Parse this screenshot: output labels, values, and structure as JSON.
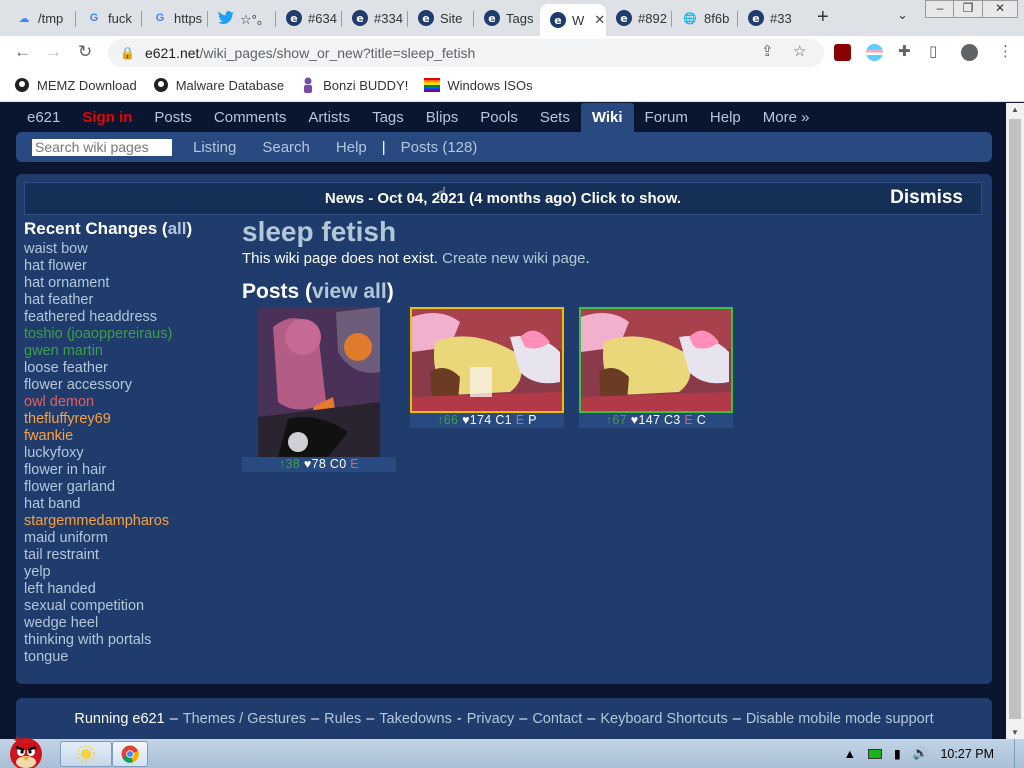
{
  "browser": {
    "tabs": [
      {
        "title": "/tmp",
        "icon": "upload-icon"
      },
      {
        "title": "fuck",
        "icon": "google-icon"
      },
      {
        "title": "https",
        "icon": "google-icon"
      },
      {
        "title": "☆°。",
        "icon": "twitter-icon"
      },
      {
        "title": "#634",
        "icon": "e621-icon"
      },
      {
        "title": "#334",
        "icon": "e621-icon"
      },
      {
        "title": "Site",
        "icon": "e621-icon"
      },
      {
        "title": "Tags",
        "icon": "e621-icon"
      },
      {
        "title": "W",
        "icon": "e621-icon",
        "active": true
      },
      {
        "title": "#892",
        "icon": "e621-icon"
      },
      {
        "title": "8f6b",
        "icon": "globe-icon"
      },
      {
        "title": "#33",
        "icon": "e621-icon"
      }
    ],
    "url_host": "e621.net",
    "url_path": "/wiki_pages/show_or_new?title=sleep_fetish",
    "bookmarks": [
      {
        "label": "MEMZ Download",
        "icon": "github-icon"
      },
      {
        "label": "Malware Database",
        "icon": "github-icon"
      },
      {
        "label": "Bonzi BUDDY!",
        "icon": "bonzi-icon"
      },
      {
        "label": "Windows ISOs",
        "icon": "windows-flag-icon"
      }
    ]
  },
  "site": {
    "nav": [
      "e621",
      "Sign in",
      "Posts",
      "Comments",
      "Artists",
      "Tags",
      "Blips",
      "Pools",
      "Sets",
      "Wiki",
      "Forum",
      "Help",
      "More »"
    ],
    "subnav": {
      "search_placeholder": "Search wiki pages",
      "listing": "Listing",
      "search": "Search",
      "help": "Help",
      "pipe": "|",
      "posts": "Posts (128)"
    },
    "news": {
      "text": "News - Oct 04, 2021 (4 months ago) Click to show.",
      "dismiss": "Dismiss"
    },
    "recent_changes": {
      "title": "Recent Changes",
      "paren_open": " (",
      "all": "all",
      "paren_close": ")",
      "items": [
        {
          "label": "waist bow",
          "color": "default"
        },
        {
          "label": "hat flower",
          "color": "default"
        },
        {
          "label": "hat ornament",
          "color": "default"
        },
        {
          "label": "hat feather",
          "color": "default"
        },
        {
          "label": "feathered headdress",
          "color": "default"
        },
        {
          "label": "toshio (joaoppereiraus)",
          "color": "green"
        },
        {
          "label": "gwen martin",
          "color": "green"
        },
        {
          "label": "loose feather",
          "color": "default"
        },
        {
          "label": "flower accessory",
          "color": "default"
        },
        {
          "label": "owl demon",
          "color": "red"
        },
        {
          "label": "thefluffyrey69",
          "color": "orange"
        },
        {
          "label": "fwankie",
          "color": "orange"
        },
        {
          "label": "luckyfoxy",
          "color": "default"
        },
        {
          "label": "flower in hair",
          "color": "default"
        },
        {
          "label": "flower garland",
          "color": "default"
        },
        {
          "label": "hat band",
          "color": "default"
        },
        {
          "label": "stargemmedampharos",
          "color": "orange"
        },
        {
          "label": "maid uniform",
          "color": "default"
        },
        {
          "label": "tail restraint",
          "color": "default"
        },
        {
          "label": "yelp",
          "color": "default"
        },
        {
          "label": "left handed",
          "color": "default"
        },
        {
          "label": "sexual competition",
          "color": "default"
        },
        {
          "label": "wedge heel",
          "color": "default"
        },
        {
          "label": "thinking with portals",
          "color": "default"
        },
        {
          "label": "tongue",
          "color": "default"
        }
      ]
    },
    "wiki": {
      "title": "sleep fetish",
      "notice": "This wiki page does not exist. ",
      "create_link": "Create new wiki page",
      "period": ".",
      "posts_heading": "Posts",
      "view_all_open": " (",
      "view_all": "view all",
      "view_all_close": ")"
    },
    "posts": [
      {
        "score": "↑38",
        "favs": "♥78",
        "comments": "C0",
        "rating": "E",
        "extra": "",
        "border": "none"
      },
      {
        "score": "↑66",
        "favs": "♥174",
        "comments": "C1",
        "rating": "E",
        "extra": "P",
        "border": "yellow"
      },
      {
        "score": "↑67",
        "favs": "♥147",
        "comments": "C3",
        "rating": "E",
        "extra": "C",
        "border": "green"
      }
    ],
    "footer": {
      "running": "Running e621",
      "links": [
        "Themes / Gestures",
        "Rules",
        "Takedowns",
        "Privacy",
        "Contact",
        "Keyboard Shortcuts",
        "Disable mobile mode support"
      ]
    }
  },
  "taskbar": {
    "time": "10:27 PM"
  }
}
